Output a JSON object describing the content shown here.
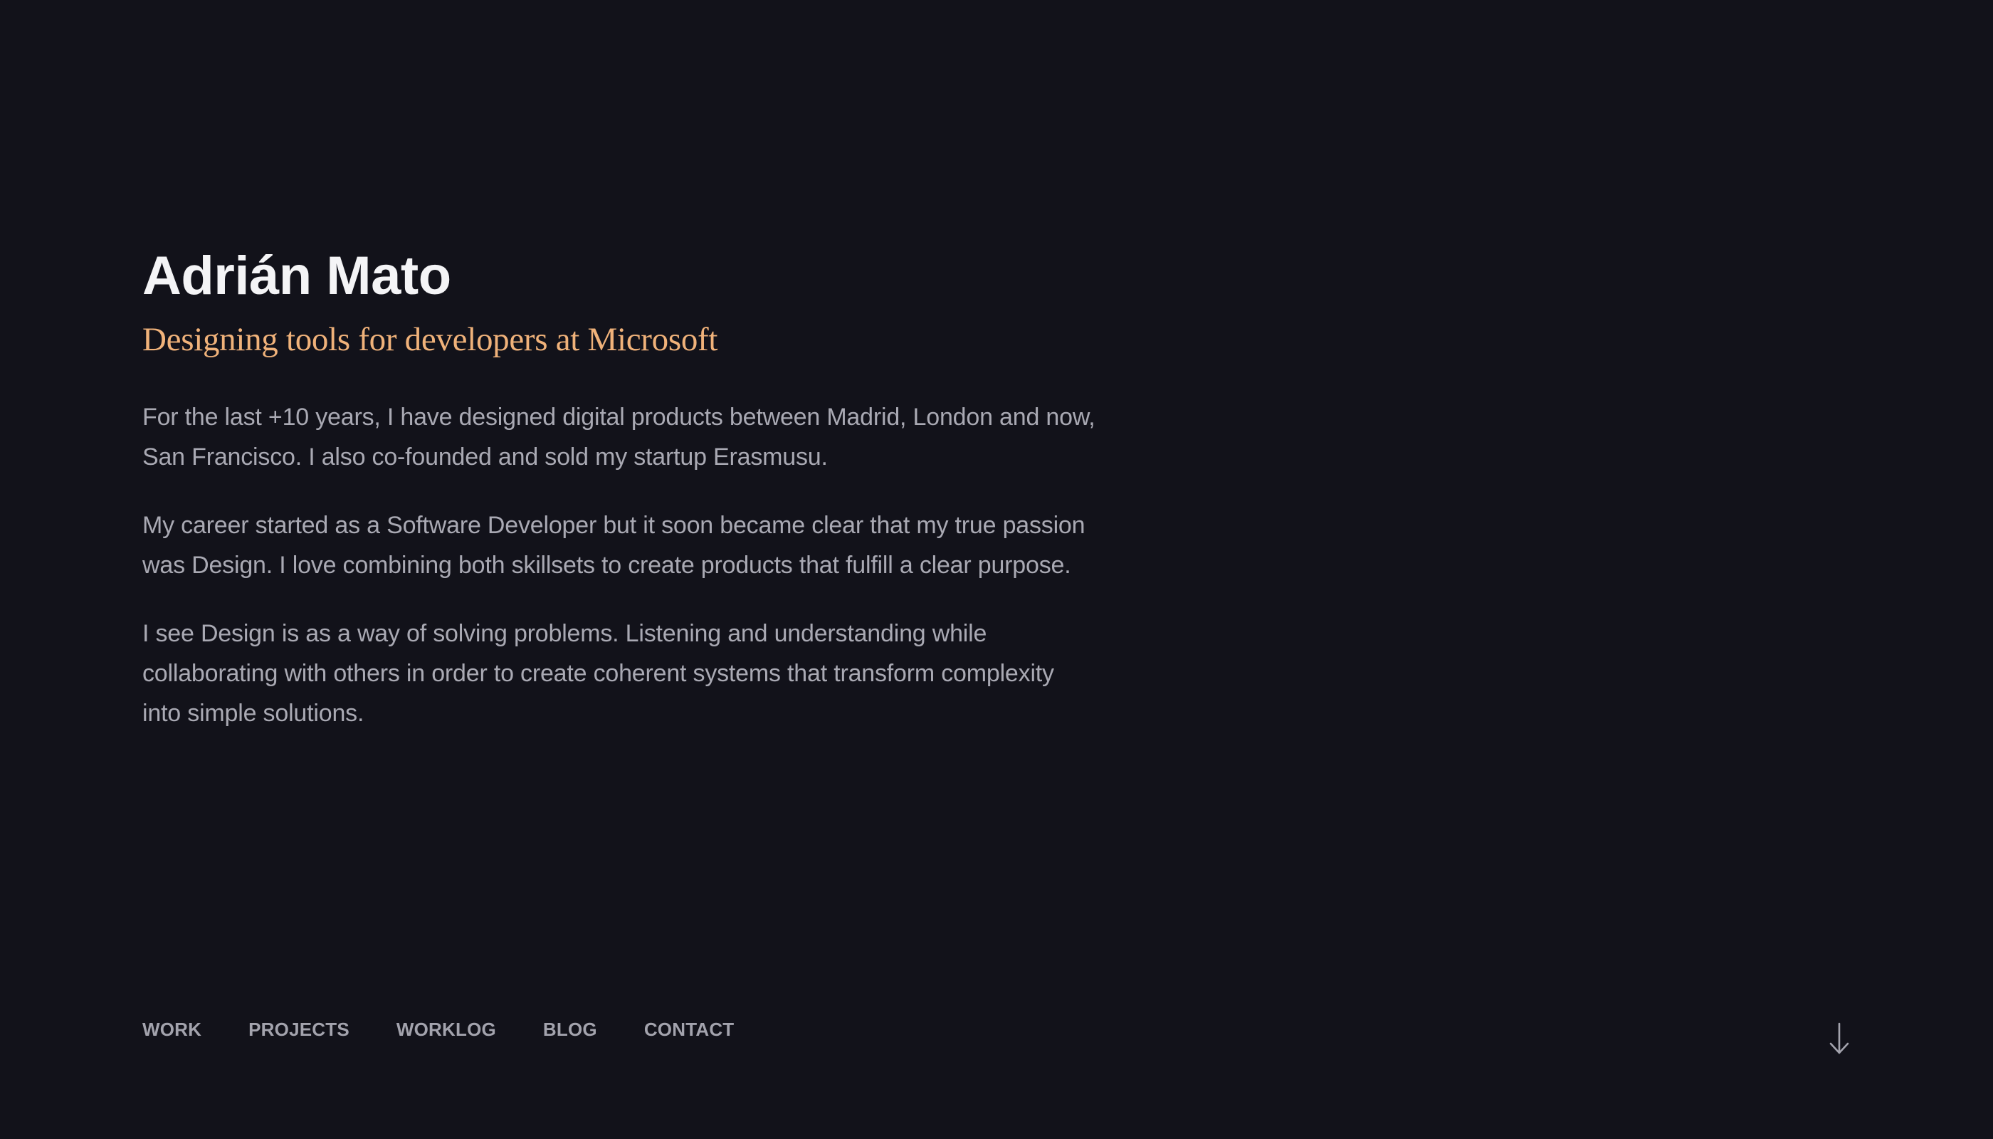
{
  "profile": {
    "name": "Adrián Mato",
    "tagline": "Designing tools for developers at Microsoft",
    "bio": [
      "For the last +10 years, I have designed digital products between Madrid, London and now, San Francisco. I also co-founded and sold my startup Erasmusu.",
      "My career started as a Software Developer but it soon became clear that my true passion was Design. I love combining both skillsets to create products that fulfill a clear purpose.",
      "I see Design is as a way of solving problems. Listening and understanding while collaborating with others in order to create coherent systems that transform complexity into simple solutions."
    ]
  },
  "nav": {
    "items": [
      {
        "label": "WORK"
      },
      {
        "label": "PROJECTS"
      },
      {
        "label": "WORKLOG"
      },
      {
        "label": "BLOG"
      },
      {
        "label": "CONTACT"
      }
    ]
  },
  "icons": {
    "scroll": "arrow-down-icon"
  },
  "colors": {
    "background": "#12121a",
    "heading": "#f4f4f6",
    "accent": "#f0b27a",
    "body_text": "#a9a9b3",
    "nav_text": "#a3a3ad"
  }
}
